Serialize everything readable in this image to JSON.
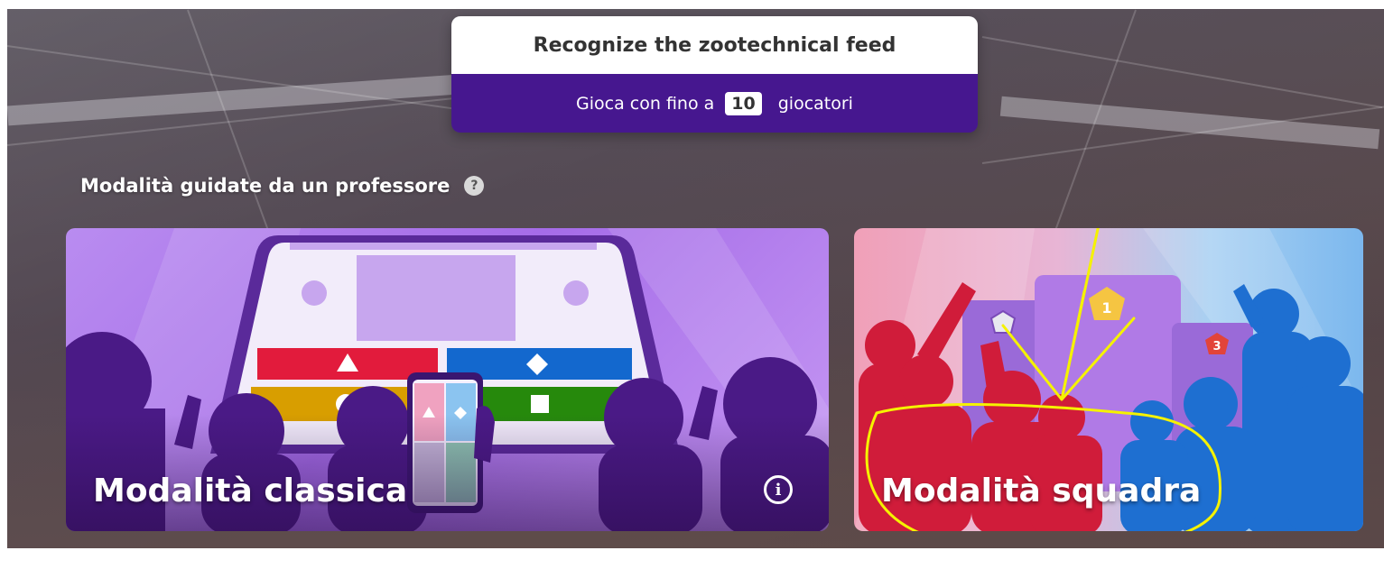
{
  "header": {
    "title": "Recognize the zootechnical feed",
    "players_prefix": "Gioca con fino a",
    "players_count": "10",
    "players_suffix": "giocatori"
  },
  "section": {
    "label": "Modalità guidate da un professore",
    "help_icon": "?"
  },
  "modes": [
    {
      "label": "Modalità classica",
      "info_icon": "i"
    },
    {
      "label": "Modalità squadra",
      "podium_first": "1",
      "podium_third": "3"
    }
  ],
  "colors": {
    "brand_purple": "#46178f",
    "answer_red": "#e21b3c",
    "answer_blue": "#1368ce",
    "answer_yellow": "#d89e00",
    "answer_green": "#26890c",
    "annotation_yellow": "#f5f200"
  }
}
